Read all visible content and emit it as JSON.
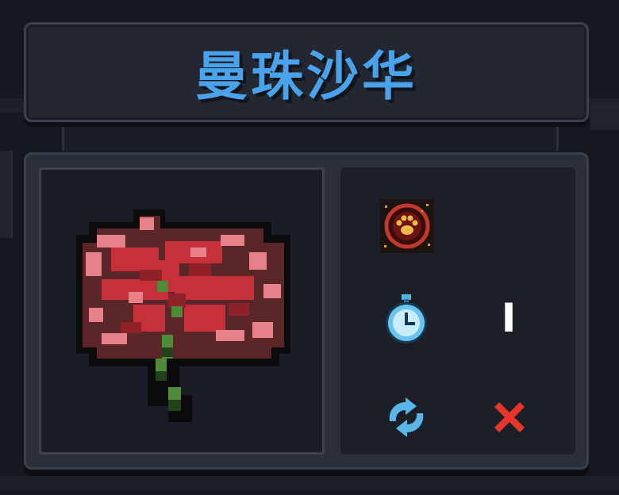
{
  "item": {
    "name": "曼珠沙华",
    "image": "red-spider-lily-pixel-art"
  },
  "effect": {
    "icon": "paw-print-icon",
    "color": "#c0392b"
  },
  "duration": {
    "icon": "stopwatch-icon",
    "value": "I"
  },
  "repeat": {
    "icon": "refresh-arrows-icon",
    "value_icon": "red-x-icon"
  },
  "colors": {
    "title": "#4aa3ea",
    "panel_bg": "#2a2f3a",
    "negative": "#e8352a",
    "accent_blue": "#5ab6e8"
  }
}
